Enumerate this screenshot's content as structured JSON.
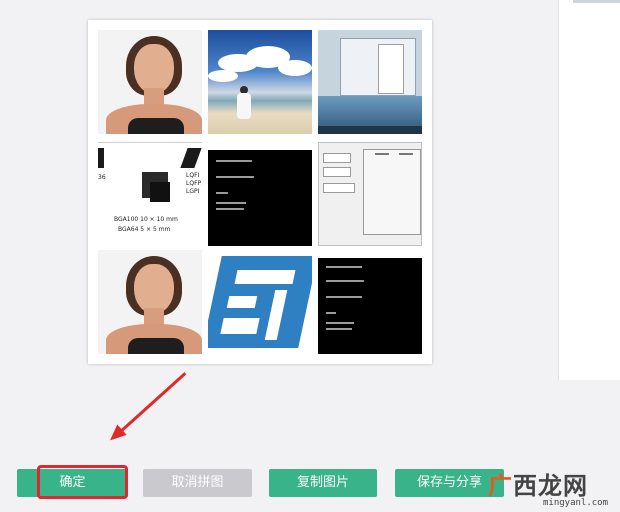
{
  "grid": {
    "chips_tile": {
      "label1": "BGA100 10 × 10 mm",
      "label2": "BGA64 5 × 5 mm",
      "left_text": "36",
      "right_text": [
        "LQFI",
        "LQFP1",
        "LGPI"
      ]
    }
  },
  "buttons": {
    "confirm": "确定",
    "cancel_collage": "取消拼图",
    "copy_image": "复制图片",
    "save_share": "保存与分享"
  },
  "watermark": {
    "logo_prefix": "广",
    "logo_rest": "西龙网",
    "url": "mingyanl.com"
  },
  "colors": {
    "accent_green": "#39b38a",
    "disabled_gray": "#c9c9ce",
    "highlight_red": "#e2262f"
  }
}
